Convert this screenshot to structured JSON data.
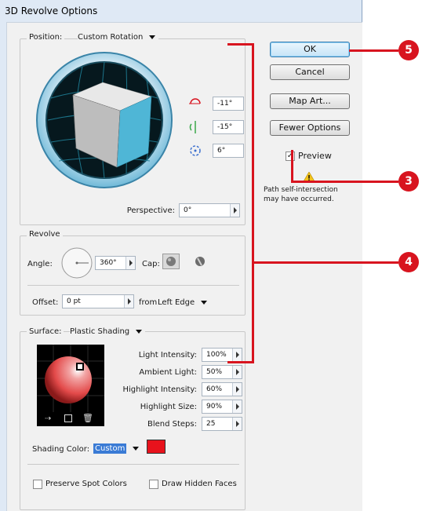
{
  "window": {
    "title": "3D Revolve Options"
  },
  "position": {
    "label": "Position:",
    "value": "Custom Rotation",
    "x_rotation": "-11°",
    "y_rotation": "-15°",
    "z_rotation": "6°",
    "perspective_label": "Perspective:",
    "perspective_value": "0°"
  },
  "revolve": {
    "title": "Revolve",
    "angle_label": "Angle:",
    "angle_value": "360°",
    "cap_label": "Cap:",
    "offset_label": "Offset:",
    "offset_value": "0 pt",
    "from_label": "from",
    "from_value": "Left Edge"
  },
  "surface": {
    "label": "Surface:",
    "value": "Plastic Shading",
    "light_intensity_label": "Light Intensity:",
    "light_intensity": "100%",
    "ambient_light_label": "Ambient Light:",
    "ambient_light": "50%",
    "highlight_intensity_label": "Highlight Intensity:",
    "highlight_intensity": "60%",
    "highlight_size_label": "Highlight Size:",
    "highlight_size": "90%",
    "blend_steps_label": "Blend Steps:",
    "blend_steps": "25",
    "shading_color_label": "Shading Color:",
    "shading_color_value": "Custom",
    "shading_swatch": "#e8121c",
    "preserve_spot_label": "Preserve Spot Colors",
    "draw_hidden_label": "Draw Hidden Faces"
  },
  "buttons": {
    "ok": "OK",
    "cancel": "Cancel",
    "map_art": "Map Art...",
    "fewer_options": "Fewer Options"
  },
  "preview": {
    "label": "Preview",
    "checked": true,
    "warning_line1": "Path self-intersection",
    "warning_line2": "may have occurred."
  },
  "callouts": [
    "5",
    "3",
    "4"
  ],
  "colors": {
    "callout": "#d8141f",
    "cube_front": "#4fb6d6",
    "dialog_bg": "#dfe9f5"
  }
}
